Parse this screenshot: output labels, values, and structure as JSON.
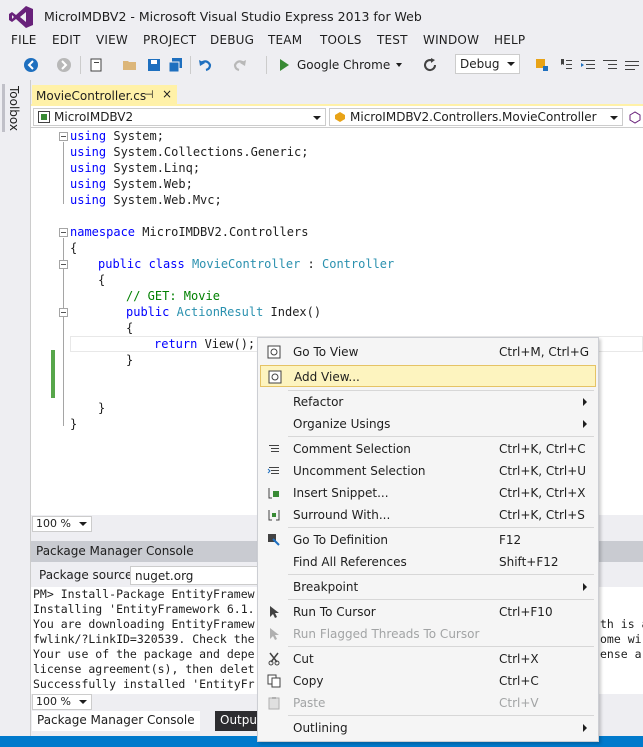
{
  "window": {
    "title": "MicroIMDBV2 - Microsoft Visual Studio Express 2013 for Web"
  },
  "menu": [
    "FILE",
    "EDIT",
    "VIEW",
    "PROJECT",
    "DEBUG",
    "TEAM",
    "TOOLS",
    "TEST",
    "WINDOW",
    "HELP"
  ],
  "toolbar": {
    "run_label": "Google Chrome",
    "config": "Debug"
  },
  "toolbox": {
    "label": "Toolbox"
  },
  "doc_tab": {
    "name": "MovieController.cs",
    "pin": "⊣",
    "close": "×"
  },
  "navbar": {
    "project": "MicroIMDBV2",
    "class": "MicroIMDBV2.Controllers.MovieController"
  },
  "code": {
    "l1_kw": "using",
    "l1_rest": " System;",
    "l2_kw": "using",
    "l2_rest": " System.Collections.Generic;",
    "l3_kw": "using",
    "l3_rest": " System.Linq;",
    "l4_kw": "using",
    "l4_rest": " System.Web;",
    "l5_kw": "using",
    "l5_rest": " System.Web.Mvc;",
    "ns_kw": "namespace",
    "ns_rest": " MicroIMDBV2.Controllers",
    "open1": "{",
    "cls_kw": "public class",
    "cls_name": "MovieController",
    "cls_colon": " : ",
    "cls_base": "Controller",
    "open2": "{",
    "comment": "// GET: Movie",
    "m_kw": "public",
    "m_type": "ActionResult",
    "m_rest": " Index()",
    "open3": "{",
    "ret_kw": "return",
    "ret_rest": " View();",
    "close3": "}",
    "close2": "}",
    "close1": "}"
  },
  "editor_zoom": "100 %",
  "pmc": {
    "title": "Package Manager Console",
    "source_label": "Package source:",
    "source_value": "nuget.org",
    "output": [
      "PM> Install-Package EntityFramew",
      "Installing 'EntityFramework 6.1.",
      "You are downloading EntityFramew",
      "fwlink/?LinkID=320539. Check the",
      "Your use of the package and depe",
      "license agreement(s), then delet",
      "Successfully installed 'EntityFr"
    ],
    "output_right": [
      "",
      "",
      "th is a",
      "ome wi",
      "ense a",
      "",
      ""
    ],
    "zoom": "100 %"
  },
  "bottom_tabs": {
    "pmc": "Package Manager Console",
    "output": "Output"
  },
  "context_menu": [
    {
      "label": "Go To View",
      "shortcut": "Ctrl+M, Ctrl+G",
      "icon": "view-icon"
    },
    {
      "label": "Add View...",
      "shortcut": "",
      "icon": "view-icon",
      "highlighted": true
    },
    {
      "label": "Refactor",
      "shortcut": "",
      "submenu": true
    },
    {
      "label": "Organize Usings",
      "shortcut": "",
      "submenu": true
    },
    {
      "label": "Comment Selection",
      "shortcut": "Ctrl+K, Ctrl+C",
      "icon": "comment-icon"
    },
    {
      "label": "Uncomment Selection",
      "shortcut": "Ctrl+K, Ctrl+U",
      "icon": "uncomment-icon"
    },
    {
      "label": "Insert Snippet...",
      "shortcut": "Ctrl+K, Ctrl+X",
      "icon": "snippet-icon"
    },
    {
      "label": "Surround With...",
      "shortcut": "Ctrl+K, Ctrl+S",
      "icon": "surround-icon"
    },
    {
      "label": "Go To Definition",
      "shortcut": "F12",
      "icon": "goto-definition-icon"
    },
    {
      "label": "Find All References",
      "shortcut": "Shift+F12"
    },
    {
      "label": "Breakpoint",
      "shortcut": "",
      "submenu": true
    },
    {
      "label": "Run To Cursor",
      "shortcut": "Ctrl+F10",
      "icon": "cursor-icon"
    },
    {
      "label": "Run Flagged Threads To Cursor",
      "shortcut": "",
      "icon": "cursor-icon",
      "disabled": true
    },
    {
      "label": "Cut",
      "shortcut": "Ctrl+X",
      "icon": "scissors-icon"
    },
    {
      "label": "Copy",
      "shortcut": "Ctrl+C",
      "icon": "copy-icon"
    },
    {
      "label": "Paste",
      "shortcut": "Ctrl+V",
      "icon": "paste-icon",
      "disabled": true
    },
    {
      "label": "Outlining",
      "shortcut": "",
      "submenu": true
    }
  ]
}
